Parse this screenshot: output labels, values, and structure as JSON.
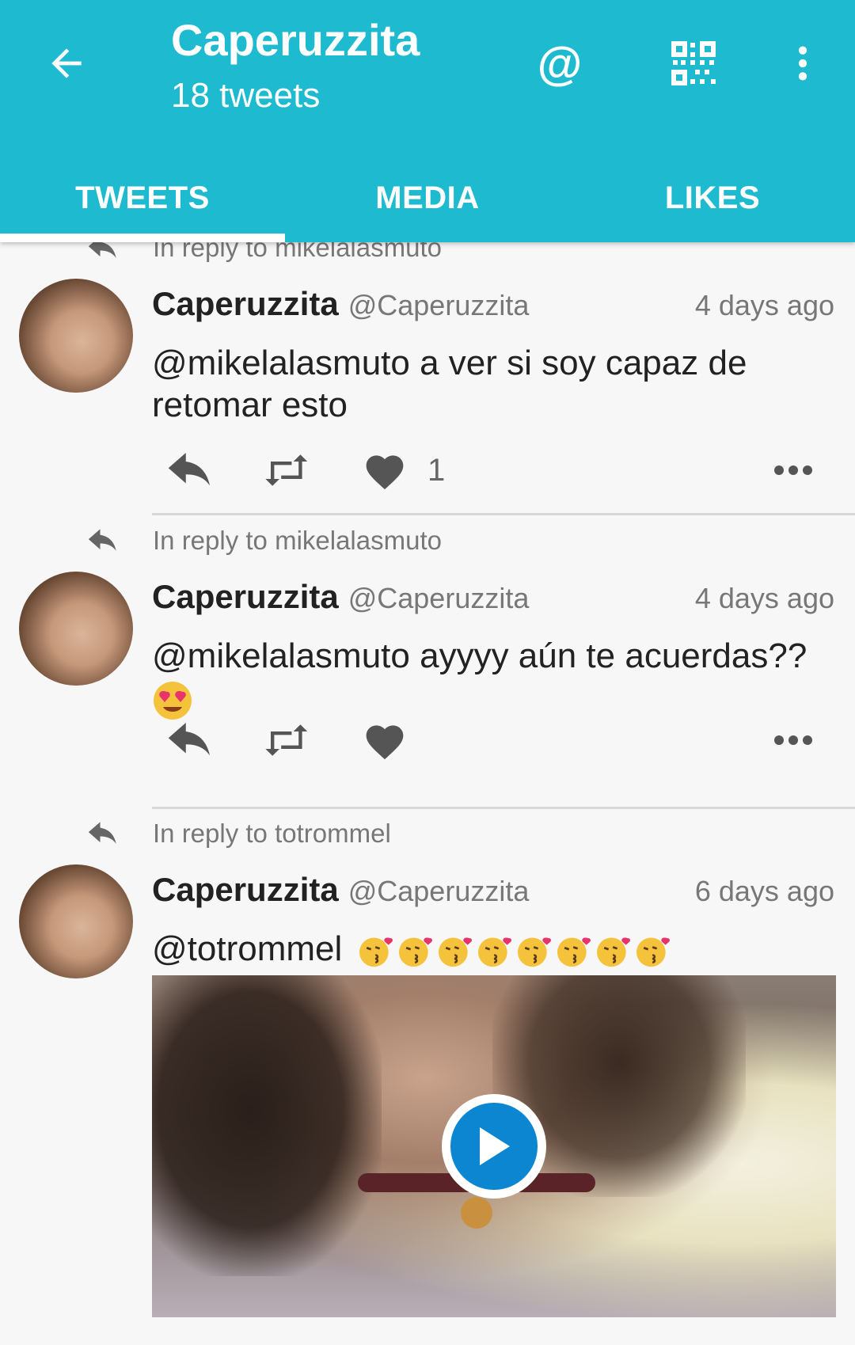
{
  "appbar": {
    "title": "Caperuzzita",
    "subtitle": "18 tweets",
    "bg_color": "#1ebbd0",
    "icons": [
      "arrow-back-icon",
      "at-icon",
      "qr-code-icon",
      "more-vert-icon"
    ],
    "at_symbol": "@"
  },
  "tabs": [
    {
      "label": "TWEETS",
      "active": true
    },
    {
      "label": "MEDIA",
      "active": false
    },
    {
      "label": "LIKES",
      "active": false
    }
  ],
  "tweets": [
    {
      "reply_to": "In reply to mikelalasmuto",
      "name": "Caperuzzita",
      "handle": "@Caperuzzita",
      "time": "4 days ago",
      "text": "@mikelalasmuto a ver si soy capaz de retomar esto",
      "likes": "1"
    },
    {
      "reply_to": "In reply to mikelalasmuto",
      "name": "Caperuzzita",
      "handle": "@Caperuzzita",
      "time": "4 days ago",
      "text": "@mikelalasmuto ayyyy aún te acuerdas??",
      "emoji": "smiling-face-with-heart-eyes"
    },
    {
      "reply_to": "In reply to totrommel",
      "name": "Caperuzzita",
      "handle": "@Caperuzzita",
      "time": "6 days ago",
      "text": "@totrommel",
      "emoji": "face-blowing-a-kiss",
      "emoji_count": 8,
      "media": "video"
    }
  ],
  "colors": {
    "accent": "#1ebbd0",
    "play_button": "#0d86d1",
    "icon_gray": "#555555"
  }
}
